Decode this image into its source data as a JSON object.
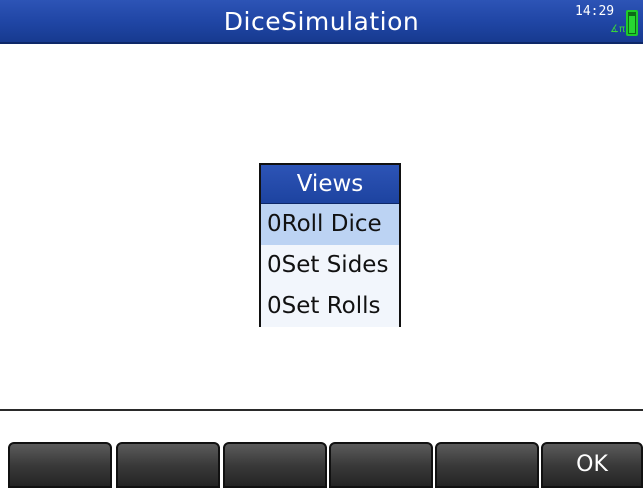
{
  "app": {
    "title": "DiceSimulation",
    "time": "14:29",
    "angle_mode": "∡π",
    "battery_icon": "battery-icon"
  },
  "menu": {
    "title": "Views",
    "items": [
      {
        "label": "0Roll Dice",
        "selected": true
      },
      {
        "label": "0Set Sides",
        "selected": false
      },
      {
        "label": "0Set Rolls",
        "selected": false
      }
    ]
  },
  "softkeys": [
    "",
    "",
    "",
    "",
    "",
    "OK"
  ],
  "colors": {
    "titlebar": "#1f45a4",
    "selection": "#bcd3f3",
    "softkey": "#3a3a3a",
    "battery": "#27d632"
  }
}
